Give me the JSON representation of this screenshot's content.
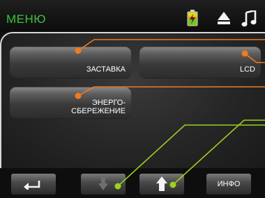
{
  "header": {
    "title": "МЕНЮ",
    "icons": [
      "battery-charging-icon",
      "eject-icon",
      "music-note-icon"
    ]
  },
  "menu": {
    "buttons": [
      {
        "label": "ЗАСТАВКА"
      },
      {
        "label": "LCD"
      },
      {
        "label": "ЭНЕРГО-\nСБЕРЕЖЕНИЕ"
      }
    ]
  },
  "footer": {
    "info_label": "ИНФО",
    "icons": [
      "back-arrow-icon",
      "down-arrow-icon",
      "up-arrow-icon"
    ]
  },
  "colors": {
    "title": "#3cc53c",
    "callout_orange": "#f07a1e",
    "callout_green": "#9bd21e"
  }
}
